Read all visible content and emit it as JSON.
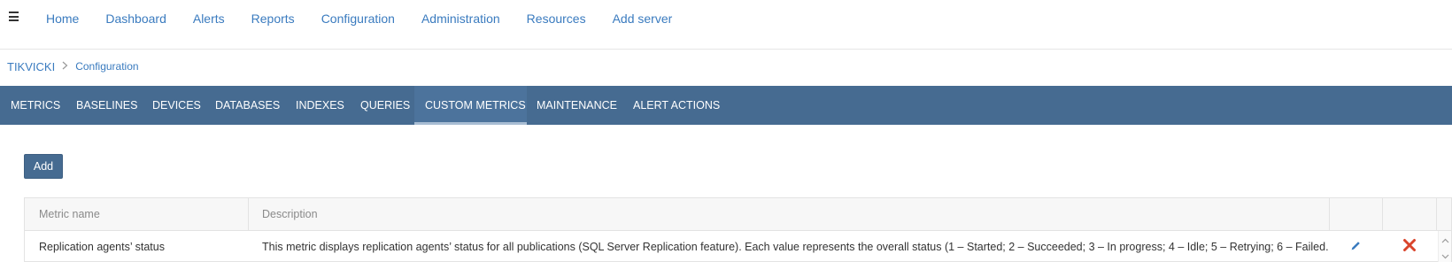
{
  "nav": {
    "menu_icon": "hamburger-icon",
    "links": [
      "Home",
      "Dashboard",
      "Alerts",
      "Reports",
      "Configuration",
      "Administration",
      "Resources",
      "Add server"
    ]
  },
  "breadcrumb": {
    "root": "TIKVICKI",
    "separator_icon": "chevron-right-icon",
    "current": "Configuration"
  },
  "tabs": {
    "items": [
      "METRICS",
      "BASELINES",
      "DEVICES",
      "DATABASES",
      "INDEXES",
      "QUERIES",
      "CUSTOM METRICS",
      "MAINTENANCE",
      "ALERT ACTIONS"
    ],
    "active": "CUSTOM METRICS"
  },
  "toolbar": {
    "add_label": "Add"
  },
  "table": {
    "columns": [
      "Metric name",
      "Description"
    ],
    "rows": [
      {
        "name": "Replication agents’ status",
        "description": "This metric displays replication agents’ status for all publications (SQL Server Replication feature). Each value represents the overall status (1 – Started; 2 – Succeeded; 3 – In progress; 4 – Idle; 5 – Retrying; 6 – Failed.",
        "edit_icon": "pencil-icon",
        "delete_icon": "close-icon"
      }
    ]
  },
  "colors": {
    "link": "#3a7bbf",
    "tabbar": "#466b91",
    "delete": "#d9442b"
  }
}
